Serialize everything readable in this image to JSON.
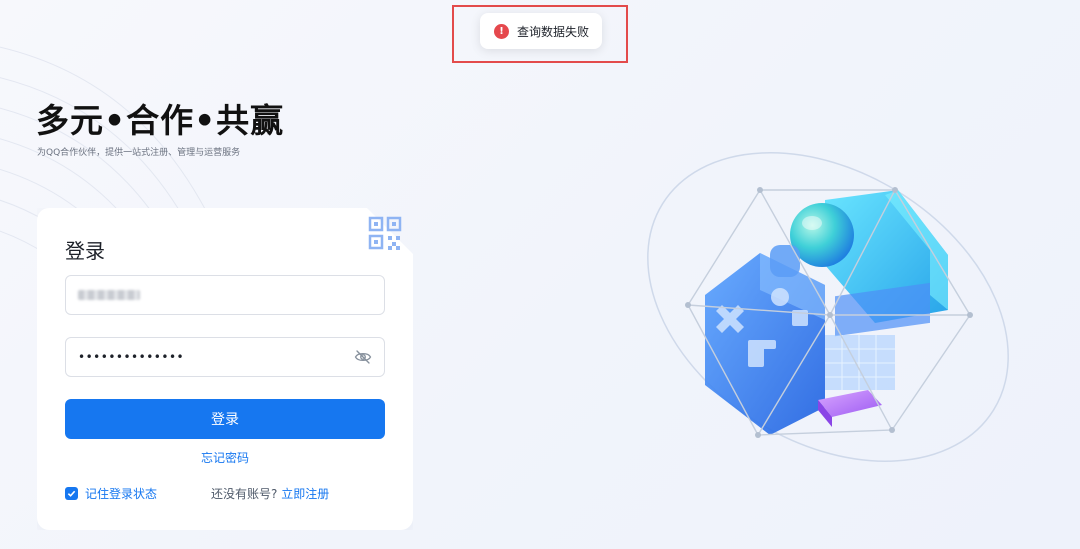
{
  "toast": {
    "message": "查询数据失败",
    "icon": "error-icon",
    "icon_glyph": "!"
  },
  "hero": {
    "title": "多元•合作•共赢",
    "subtitle": "为QQ合作伙伴，提供一站式注册、管理与运营服务"
  },
  "login": {
    "title": "登录",
    "username_value": "",
    "password_value": "••••••••••••••",
    "submit_label": "登录",
    "forgot_label": "忘记密码",
    "remember_label": "记住登录状态",
    "remember_checked": true,
    "no_account_text": "还没有账号?",
    "signup_label": "立即注册"
  },
  "colors": {
    "primary": "#1677f0",
    "error": "#e5484d",
    "highlight": "#e34b4b"
  }
}
